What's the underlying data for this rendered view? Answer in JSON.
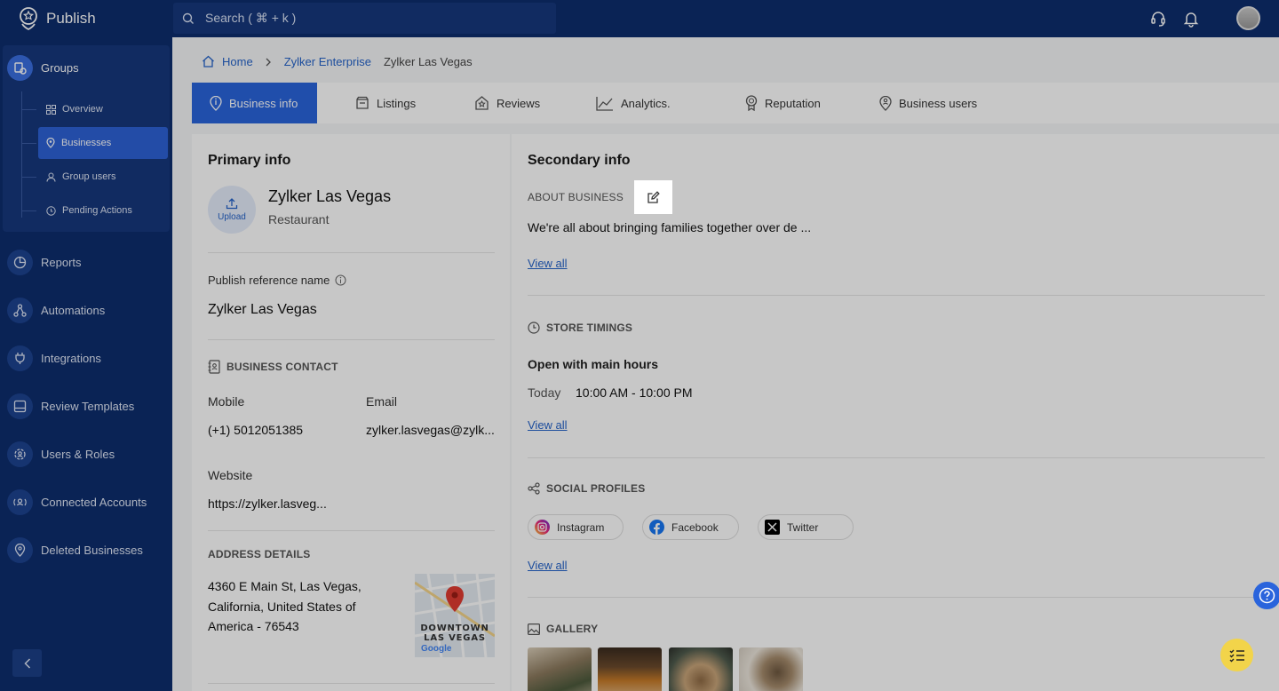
{
  "app": {
    "name": "Publish"
  },
  "search": {
    "placeholder": "Search ( ⌘ + k )"
  },
  "sidebar": {
    "groups_label": "Groups",
    "sub_items": [
      {
        "label": "Overview",
        "icon": "grid-icon"
      },
      {
        "label": "Businesses",
        "icon": "location-pin-icon",
        "active": true
      },
      {
        "label": "Group users",
        "icon": "user-icon"
      },
      {
        "label": "Pending Actions",
        "icon": "clock-icon"
      }
    ],
    "items": [
      {
        "label": "Reports",
        "icon": "pie-chart-icon"
      },
      {
        "label": "Automations",
        "icon": "workflow-icon"
      },
      {
        "label": "Integrations",
        "icon": "plug-icon"
      },
      {
        "label": "Review Templates",
        "icon": "template-icon"
      },
      {
        "label": "Users & Roles",
        "icon": "gear-user-icon"
      },
      {
        "label": "Connected Accounts",
        "icon": "connected-users-icon"
      },
      {
        "label": "Deleted Businesses",
        "icon": "location-pin-icon"
      }
    ]
  },
  "breadcrumb": {
    "home": "Home",
    "enterprise": "Zylker Enterprise",
    "current": "Zylker Las Vegas"
  },
  "tabs": [
    {
      "label": "Business info",
      "icon": "info-pin-icon",
      "active": true
    },
    {
      "label": "Listings",
      "icon": "listing-icon"
    },
    {
      "label": "Reviews",
      "icon": "review-icon"
    },
    {
      "label": "Analytics.",
      "icon": "analytics-icon"
    },
    {
      "label": "Reputation",
      "icon": "badge-icon"
    },
    {
      "label": "Business users",
      "icon": "business-user-icon"
    }
  ],
  "primary": {
    "title": "Primary info",
    "upload_label": "Upload",
    "business_name": "Zylker Las Vegas",
    "business_type": "Restaurant",
    "ref_label": "Publish reference name",
    "ref_value": "Zylker Las Vegas",
    "contact_heading": "BUSINESS CONTACT",
    "mobile_label": "Mobile",
    "mobile_value": "(+1) 5012051385",
    "email_label": "Email",
    "email_value": "zylker.lasvegas@zylk...",
    "website_label": "Website",
    "website_value": "https://zylker.lasveg...",
    "address_heading": "ADDRESS DETAILS",
    "address_lines": [
      "4360 E Main St, Las Vegas,",
      "California, United States of",
      "America - 76543"
    ],
    "map_label_1": "DOWNTOWN",
    "map_label_2": "LAS VEGAS",
    "map_brand": "Google"
  },
  "secondary": {
    "title": "Secondary info",
    "about_heading": "ABOUT BUSINESS",
    "about_text": "We're all about bringing families together over de ...",
    "view_all": "View all",
    "timings_heading": "STORE TIMINGS",
    "timings_sub": "Open with main hours",
    "today_label": "Today",
    "today_hours": "10:00 AM - 10:00 PM",
    "social_heading": "SOCIAL PROFILES",
    "socials": [
      "Instagram",
      "Facebook",
      "Twitter"
    ],
    "gallery_heading": "GALLERY"
  },
  "colors": {
    "nav": "#0d2d6e",
    "accent": "#2a64dc",
    "link": "#2563c9"
  }
}
